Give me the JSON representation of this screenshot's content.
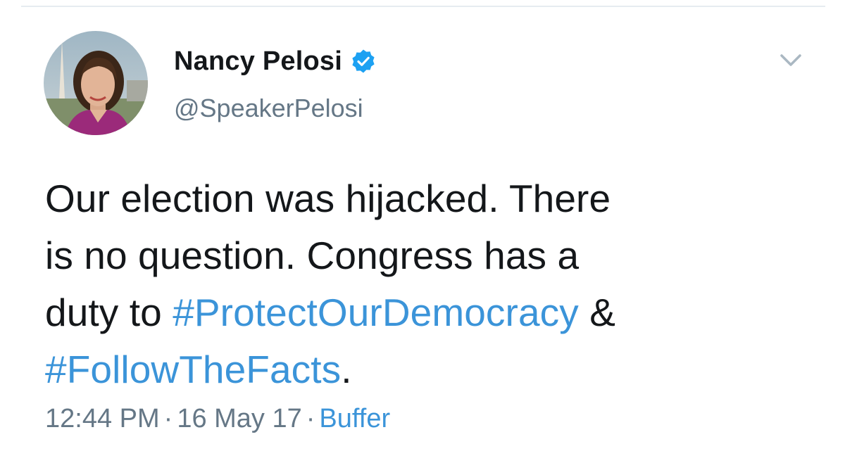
{
  "author": {
    "display_name": "Nancy Pelosi",
    "handle": "@SpeakerPelosi",
    "verified": true
  },
  "tweet": {
    "lines": [
      {
        "text": "Our election was hijacked. There"
      },
      {
        "text": "is no question. Congress has a"
      },
      {
        "prefix": "duty to ",
        "hashtag": "#ProtectOurDemocracy",
        "suffix": " &"
      },
      {
        "hashtag": "#FollowTheFacts",
        "suffix": "."
      }
    ]
  },
  "meta": {
    "time": "12:44 PM",
    "separator": "·",
    "date": "16 May 17",
    "source": "Buffer"
  },
  "icons": {
    "verified": "verified-badge-icon",
    "menu": "chevron-down-icon"
  },
  "colors": {
    "link": "#3b94d9",
    "text": "#14171a",
    "secondary": "#657786",
    "verified": "#1da1f2"
  }
}
